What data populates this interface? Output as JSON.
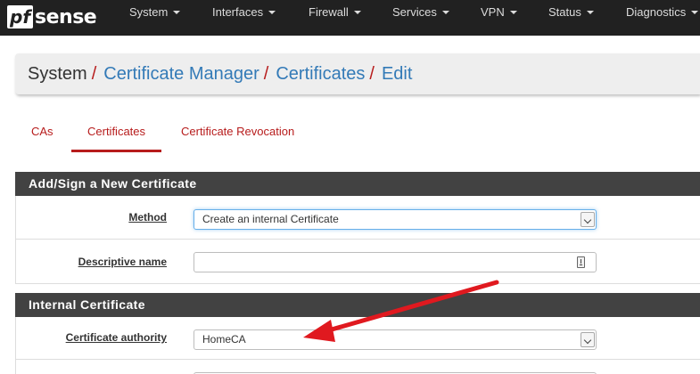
{
  "brand": {
    "logo_pf": "pf",
    "logo_sense": "sense"
  },
  "nav": {
    "items": [
      {
        "label": "System"
      },
      {
        "label": "Interfaces"
      },
      {
        "label": "Firewall"
      },
      {
        "label": "Services"
      },
      {
        "label": "VPN"
      },
      {
        "label": "Status"
      },
      {
        "label": "Diagnostics"
      }
    ]
  },
  "breadcrumb": {
    "root": "System",
    "separator": "/",
    "links": [
      "Certificate Manager",
      "Certificates",
      "Edit"
    ]
  },
  "tabs": [
    {
      "label": "CAs",
      "active": false
    },
    {
      "label": "Certificates",
      "active": true
    },
    {
      "label": "Certificate Revocation",
      "active": false
    }
  ],
  "panels": {
    "add_sign": {
      "heading": "Add/Sign a New Certificate",
      "method": {
        "label": "Method",
        "value": "Create an internal Certificate"
      },
      "descriptive_name": {
        "label": "Descriptive name",
        "value": ""
      }
    },
    "internal": {
      "heading": "Internal Certificate",
      "certificate_authority": {
        "label": "Certificate authority",
        "value": "HomeCA"
      }
    }
  },
  "colors": {
    "navbar": "#212121",
    "accent_red": "#b71c1c",
    "link_blue": "#337ab7",
    "panel_heading": "#424242",
    "annotation_arrow": "#e0191f"
  },
  "icons": {
    "dropdown": "chevron-down-icon",
    "input_keyboard": "keyboard-icon",
    "annotation": "red-arrow-annotation"
  }
}
